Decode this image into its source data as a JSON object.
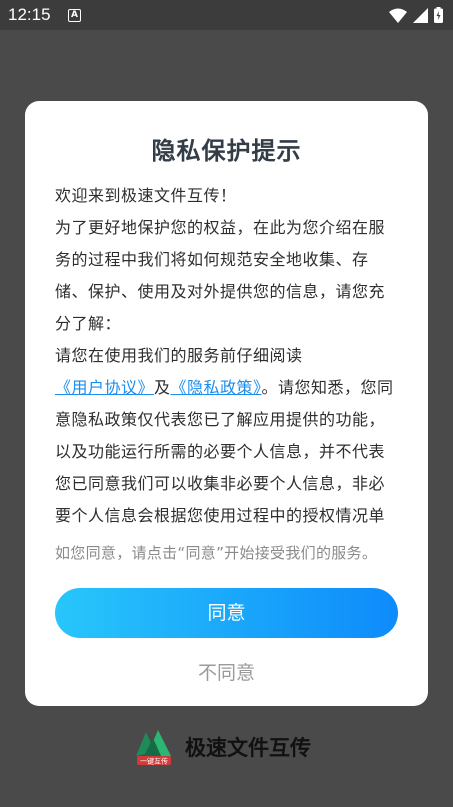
{
  "status": {
    "time": "12:15",
    "notification_letter": "A"
  },
  "dialog": {
    "title": "隐私保护提示",
    "welcome": "欢迎来到极速文件互传！",
    "intro": "为了更好地保护您的权益，在此为您介绍在服务的过程中我们将如何规范安全地收集、存储、保护、使用及对外提供您的信息，请您充分了解：",
    "read_prefix": "请您在使用我们的服务前仔细阅读",
    "user_agreement_link": "《用户协议》",
    "and": "及",
    "privacy_policy_link": "《隐私政策》",
    "read_suffix": "。请您知悉，您同意隐私政策仅代表您已了解应用提供的功能，以及功能运行所需的必要个人信息，并不代表您已同意我们可以收集非必要个人信息，非必要个人信息会根据您使用过程中的授权情况单独征求",
    "note": "如您同意，请点击“同意”开始接受我们的服务。",
    "agree_label": "同意",
    "disagree_label": "不同意"
  },
  "brand": {
    "name": "极速文件互传",
    "logo_text": "一键互传"
  },
  "colors": {
    "link": "#1a8df0",
    "button_start": "#28c6fb",
    "button_end": "#0e8bfb"
  }
}
